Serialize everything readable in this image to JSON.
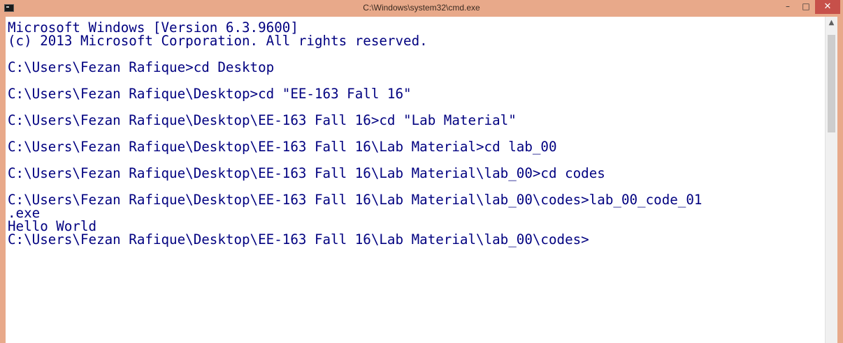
{
  "window": {
    "title": "C:\\Windows\\system32\\cmd.exe",
    "minimize_glyph": "–",
    "maximize_glyph": "□",
    "close_glyph": "✕"
  },
  "console": {
    "lines": [
      "Microsoft Windows [Version 6.3.9600]",
      "(c) 2013 Microsoft Corporation. All rights reserved.",
      "",
      "C:\\Users\\Fezan Rafique>cd Desktop",
      "",
      "C:\\Users\\Fezan Rafique\\Desktop>cd \"EE-163 Fall 16\"",
      "",
      "C:\\Users\\Fezan Rafique\\Desktop\\EE-163 Fall 16>cd \"Lab Material\"",
      "",
      "C:\\Users\\Fezan Rafique\\Desktop\\EE-163 Fall 16\\Lab Material>cd lab_00",
      "",
      "C:\\Users\\Fezan Rafique\\Desktop\\EE-163 Fall 16\\Lab Material\\lab_00>cd codes",
      "",
      "C:\\Users\\Fezan Rafique\\Desktop\\EE-163 Fall 16\\Lab Material\\lab_00\\codes>lab_00_code_01",
      ".exe",
      "Hello World",
      "C:\\Users\\Fezan Rafique\\Desktop\\EE-163 Fall 16\\Lab Material\\lab_00\\codes>"
    ]
  },
  "scrollbar": {
    "up_arrow": "▲"
  },
  "colors": {
    "titlebar": "#e8a98a",
    "close_button": "#c7504a",
    "console_text": "#000080",
    "console_background": "#ffffff"
  }
}
